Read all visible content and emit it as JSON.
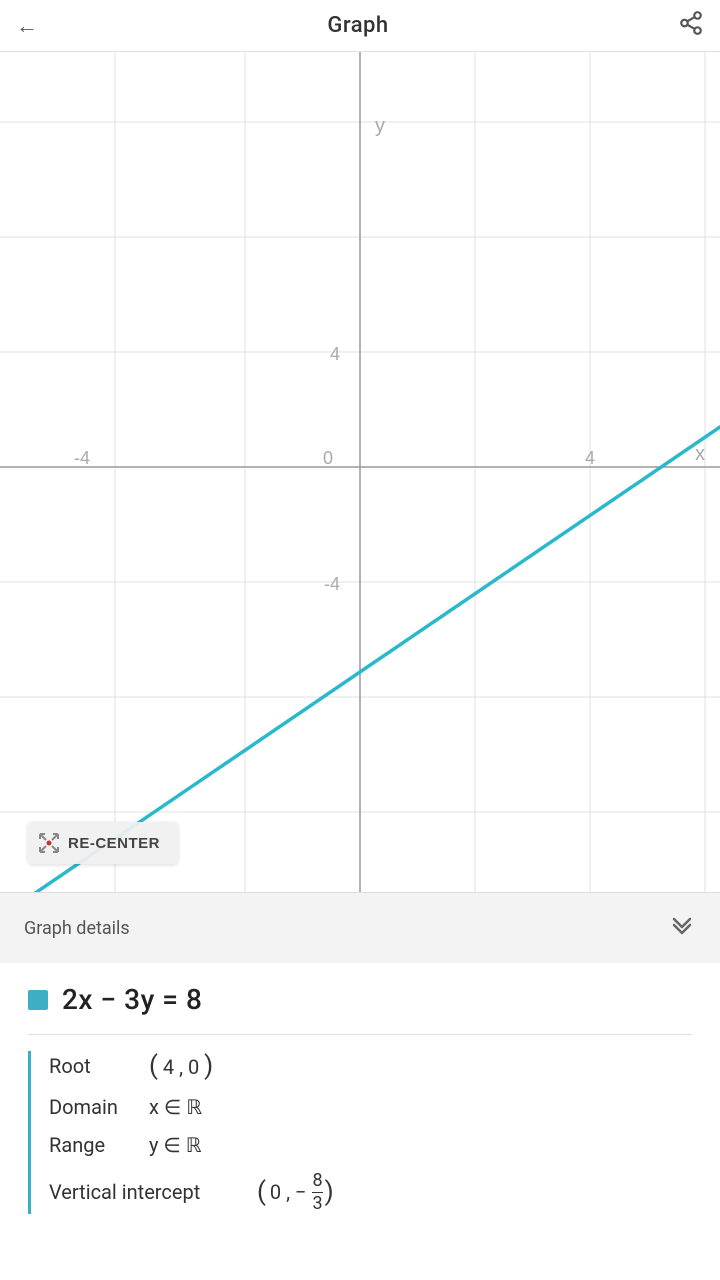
{
  "header": {
    "title": "Graph",
    "back_label": "←",
    "share_label": "share"
  },
  "graph": {
    "x_label": "x",
    "y_label": "y",
    "grid_ticks": [
      -4,
      0,
      4
    ],
    "line_color": "#2ab8cc",
    "recenter_label": "RE-CENTER"
  },
  "graph_details": {
    "section_title": "Graph details",
    "equation": "2x − 3y = 8",
    "eq_color": "#3daec4",
    "root_label": "Root",
    "root_value": "(4 , 0)",
    "domain_label": "Domain",
    "domain_value": "x ∈ ℝ",
    "range_label": "Range",
    "range_value": "y ∈ ℝ",
    "vertical_intercept_label": "Vertical intercept",
    "vertical_intercept_value_pre": "0, −",
    "fraction_num": "8",
    "fraction_den": "3"
  }
}
